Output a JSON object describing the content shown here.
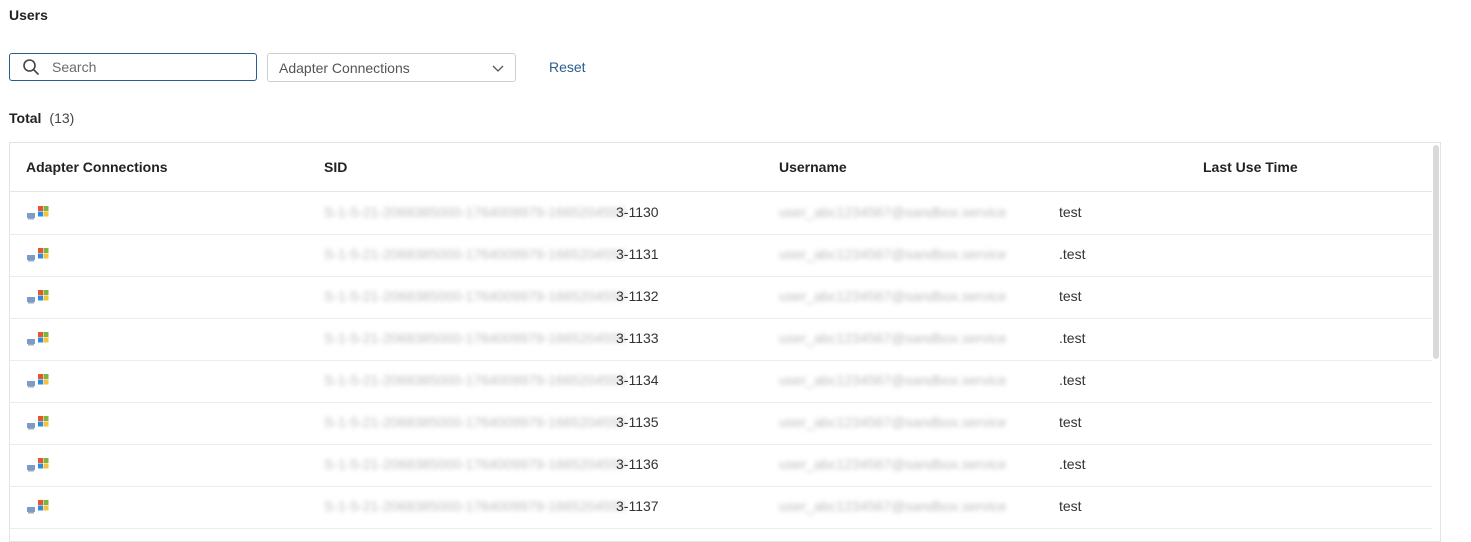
{
  "page": {
    "title": "Users"
  },
  "filters": {
    "search_placeholder": "Search",
    "search_value": "",
    "adapter_select_value": "Adapter Connections",
    "reset_label": "Reset"
  },
  "summary": {
    "total_label": "Total",
    "total_count": "(13)"
  },
  "table": {
    "columns": [
      "Adapter Connections",
      "SID",
      "Username",
      "Last Use Time"
    ],
    "rows": [
      {
        "adapter_icon": "active-directory-icon",
        "sid_suffix": "3-1130",
        "username_suffix": "test",
        "last_use_time": ""
      },
      {
        "adapter_icon": "active-directory-icon",
        "sid_suffix": "3-1131",
        "username_suffix": ".test",
        "last_use_time": ""
      },
      {
        "adapter_icon": "active-directory-icon",
        "sid_suffix": "3-1132",
        "username_suffix": "test",
        "last_use_time": ""
      },
      {
        "adapter_icon": "active-directory-icon",
        "sid_suffix": "3-1133",
        "username_suffix": ".test",
        "last_use_time": ""
      },
      {
        "adapter_icon": "active-directory-icon",
        "sid_suffix": "3-1134",
        "username_suffix": ".test",
        "last_use_time": ""
      },
      {
        "adapter_icon": "active-directory-icon",
        "sid_suffix": "3-1135",
        "username_suffix": "test",
        "last_use_time": ""
      },
      {
        "adapter_icon": "active-directory-icon",
        "sid_suffix": "3-1136",
        "username_suffix": ".test",
        "last_use_time": ""
      },
      {
        "adapter_icon": "active-directory-icon",
        "sid_suffix": "3-1137",
        "username_suffix": "test",
        "last_use_time": ""
      }
    ]
  },
  "colors": {
    "accent": "#2a5d8f",
    "border": "#e3e3e3",
    "text": "#1f1f1f"
  }
}
